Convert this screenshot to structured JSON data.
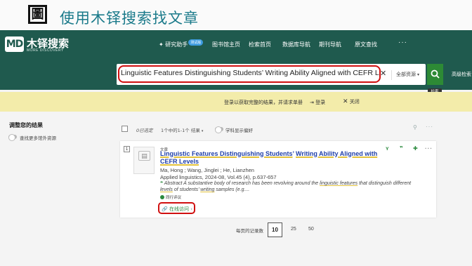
{
  "slide": {
    "logo_char": "圖",
    "title": "使用木铎搜索找文章"
  },
  "brand": {
    "md": "MD",
    "name": "木铎搜索",
    "tagline": "MORE DISCOVERY"
  },
  "nav": {
    "research_assistant": "研究助手",
    "beta": "测试版",
    "items": [
      "图书馆主页",
      "检索首页",
      "数据库导航",
      "期刊导航",
      "原文查找"
    ],
    "more": "···"
  },
  "search": {
    "query": "Linguistic Features Distinguishing Students’  Writing Ability Aligned with CEFR Levels",
    "clear": "✕",
    "scope": "全部资源",
    "submit_tooltip": "检索",
    "advanced": "高级检索"
  },
  "login_banner": {
    "message": "登录以获取完整的结果，并请求单册",
    "login": "登录",
    "close": "关闭"
  },
  "refine": {
    "title": "调整您的结果",
    "expand_label": "查找更多馆外资源"
  },
  "results_toolbar": {
    "selected": "0已选定",
    "count": "1个中的1-1个 结果",
    "discipline_label": "学科显示偏好"
  },
  "result": {
    "number": "1",
    "type": "文章",
    "title_hl1": "Linguistic Features Distinguishing Students",
    "title_rest1": "’  ",
    "title_hl2": "Writing Ability Aligned with",
    "title_hl3": "CEFR Levels",
    "authors": "Ma, Hong ; Wang, Jinglei ; He, Lianzhen",
    "citation": "Applied linguistics, 2024-08, Vol.45 (4), p.637-657",
    "abstract_p1": "Abstract A substantive body of research has been revolving around the ",
    "abstract_hl1": "linguistic features",
    "abstract_p2": " that distinguish different ",
    "abstract_hl2": "levels",
    "abstract_p3": " of students’  ",
    "abstract_hl3": "writing",
    "abstract_p4": " samples (e.g....",
    "peer_review": "同行评议",
    "online_access": "在线访问"
  },
  "pagination": {
    "label": "每页的记录数",
    "options": [
      "10",
      "25",
      "50"
    ],
    "selected": "10"
  },
  "colors": {
    "brand_green": "#1f5a4e",
    "action_green": "#2d8a35",
    "banner_yellow": "#f3ecaa",
    "link_blue": "#1f3fa8",
    "annotation_red": "#d01010"
  }
}
